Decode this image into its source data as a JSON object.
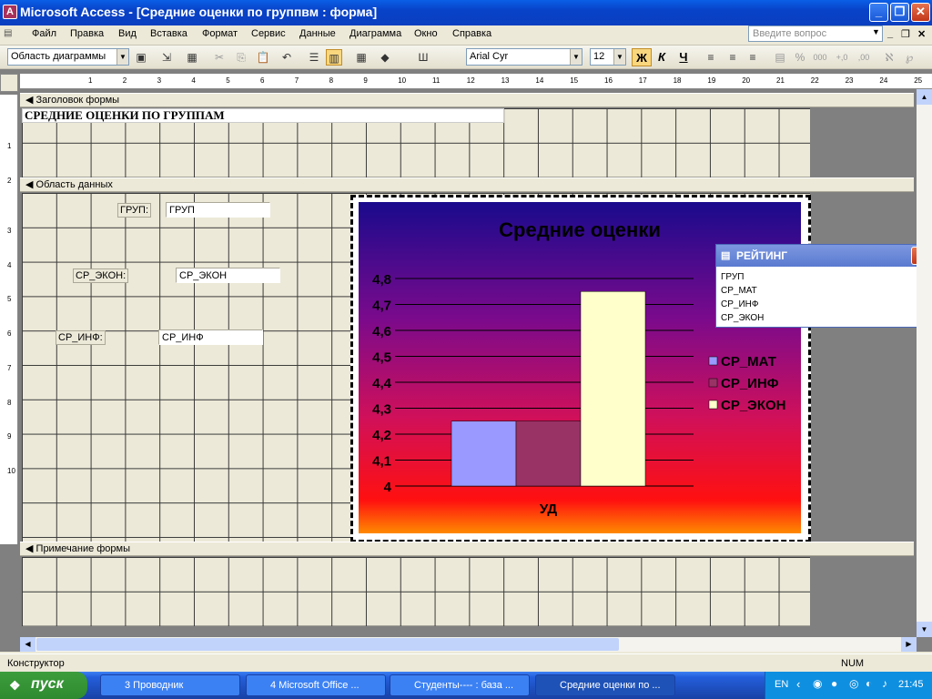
{
  "window": {
    "title": "Microsoft Access - [Средние оценки по группвм : форма]"
  },
  "menubar": {
    "items": [
      "Файл",
      "Правка",
      "Вид",
      "Вставка",
      "Формат",
      "Сервис",
      "Данные",
      "Диаграмма",
      "Окно",
      "Справка"
    ],
    "question_placeholder": "Введите вопрос"
  },
  "toolbar": {
    "object_combo": "Область диаграммы",
    "font_combo": "Arial Cyr",
    "size_combo": "12",
    "bold": "Ж",
    "italic": "К",
    "underline": "Ч"
  },
  "sections": {
    "header": "Заголовок формы",
    "detail": "Область данных",
    "footer": "Примечание формы"
  },
  "form": {
    "header_title": "СРЕДНИЕ ОЦЕНКИ ПО ГРУППАМ",
    "fields": [
      {
        "label": "ГРУП:",
        "value": "ГРУП"
      },
      {
        "label": "СР_ЭКОН:",
        "value": "СР_ЭКОН"
      },
      {
        "label": "СР_ИНФ:",
        "value": "СР_ИНФ"
      }
    ]
  },
  "rating_window": {
    "title": "РЕЙТИНГ",
    "fields": [
      "ГРУП",
      "СР_МАТ",
      "СР_ИНФ",
      "СР_ЭКОН"
    ]
  },
  "chart_data": {
    "type": "bar",
    "title": "Средние оценки",
    "categories": [
      "УД"
    ],
    "series": [
      {
        "name": "СР_МАТ",
        "values": [
          4.25
        ],
        "color": "#9999ff"
      },
      {
        "name": "СР_ИНФ",
        "values": [
          4.25
        ],
        "color": "#993366"
      },
      {
        "name": "СР_ЭКОН",
        "values": [
          4.75
        ],
        "color": "#ffffcc"
      }
    ],
    "ylim": [
      4,
      4.8
    ],
    "yticks": [
      "4",
      "4,1",
      "4,2",
      "4,3",
      "4,4",
      "4,5",
      "4,6",
      "4,7",
      "4,8"
    ],
    "grid": true,
    "legend": "right"
  },
  "status": {
    "mode": "Конструктор",
    "num": "NUM"
  },
  "taskbar": {
    "start": "пуск",
    "tasks": [
      "3 Проводник",
      "4 Microsoft Office ...",
      "Студенты---- : база ...",
      "Средние оценки по ..."
    ],
    "lang": "EN",
    "time": "21:45"
  },
  "ruler": {
    "marks": [
      "1",
      "2",
      "3",
      "4",
      "5",
      "6",
      "7",
      "8",
      "9",
      "10",
      "11",
      "12",
      "13",
      "14",
      "15",
      "16",
      "17",
      "18",
      "19",
      "20",
      "21",
      "22",
      "23",
      "24",
      "25"
    ],
    "vmarks": [
      "1",
      "2",
      "3",
      "4",
      "5",
      "6",
      "7",
      "8",
      "9",
      "10"
    ]
  }
}
